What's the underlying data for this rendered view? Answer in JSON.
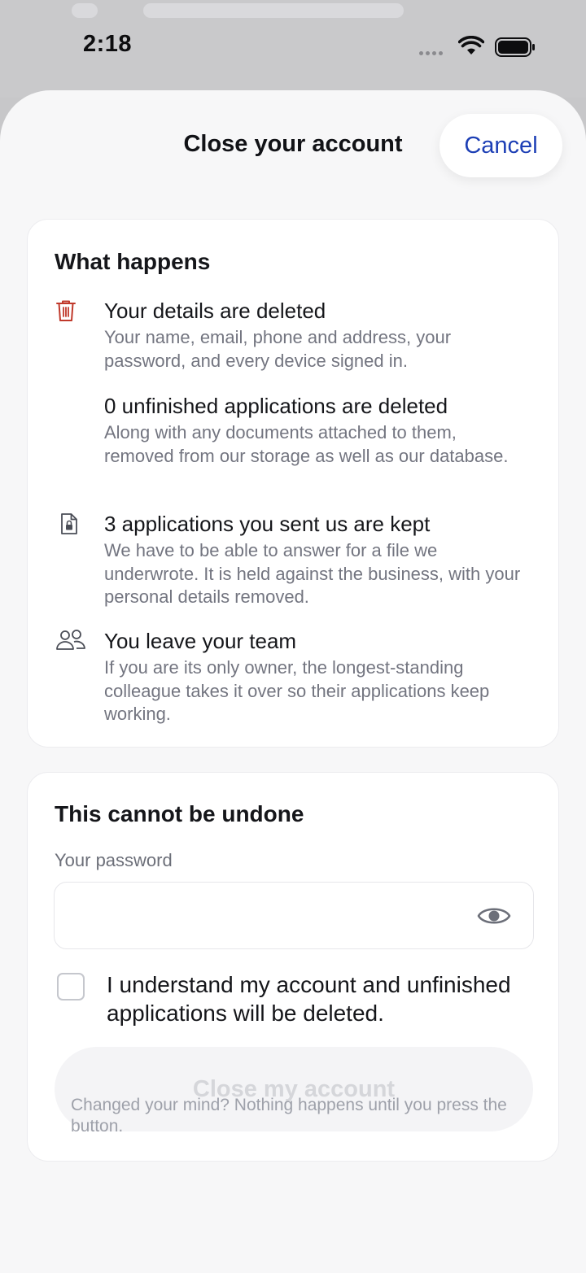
{
  "status_bar": {
    "time": "2:18",
    "icons": [
      "signal-dots-icon",
      "wifi-icon",
      "battery-icon"
    ]
  },
  "sheet": {
    "title": "Close your account",
    "cancel_label": "Cancel"
  },
  "what_happens": {
    "heading": "What happens",
    "items": [
      {
        "icon": "trash-icon",
        "title": "Your details are deleted",
        "description": "Your name, email, phone and address, your password, and every device signed in."
      },
      {
        "icon": "",
        "title": "0 unfinished applications are deleted",
        "description": "Along with any documents attached to them, removed from our storage as well as our database."
      },
      {
        "icon": "locked-document-icon",
        "title": "3 applications you sent us are kept",
        "description": "We have to be able to answer for a file we underwrote. It is held against the business, with your personal details removed."
      },
      {
        "icon": "team-icon",
        "title": "You leave your team",
        "description": "If you are its only owner, the longest-standing colleague takes it over so their applications keep working."
      }
    ]
  },
  "confirm": {
    "heading": "This cannot be undone",
    "password_label": "Your password",
    "password_value": "",
    "password_placeholder": "",
    "show_password_icon": "eye-icon",
    "checkbox_checked": false,
    "checkbox_label": "I understand my account and unfinished applications will be deleted.",
    "submit_label": "Close my account",
    "submit_enabled": false
  },
  "footer_note": "Changed your mind? Nothing happens until you press the button.",
  "colors": {
    "accent": "#1d3fb5",
    "danger_icon": "#c0392b",
    "muted_text": "#737580",
    "sheet_background": "#f7f7f8"
  }
}
